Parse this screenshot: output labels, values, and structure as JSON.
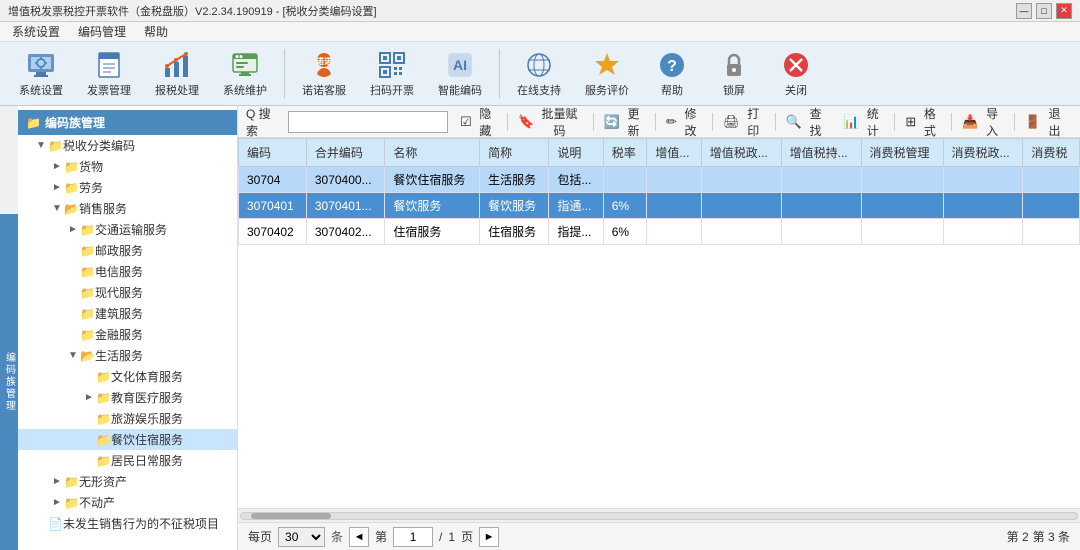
{
  "title_bar": {
    "text": "增值税发票税控开票软件（金税盘版）V2.2.34.190919 - [税收分类编码设置]",
    "controls": [
      "—",
      "□",
      "✕"
    ]
  },
  "menu": {
    "items": [
      "系统设置",
      "编码管理",
      "帮助"
    ]
  },
  "toolbar": {
    "buttons": [
      {
        "id": "sys-settings",
        "icon": "⚙",
        "label": "系统设置"
      },
      {
        "id": "invoice-mgmt",
        "icon": "📋",
        "label": "发票管理"
      },
      {
        "id": "tax-process",
        "icon": "📊",
        "label": "报税处理"
      },
      {
        "id": "sys-maintain",
        "icon": "🔧",
        "label": "系统维护"
      },
      {
        "separator": true
      },
      {
        "id": "nuonuo",
        "icon": "👤",
        "label": "诺诺客服"
      },
      {
        "id": "scan",
        "icon": "📷",
        "label": "扫码开票"
      },
      {
        "id": "smart-code",
        "icon": "🧠",
        "label": "智能编码"
      },
      {
        "separator": true
      },
      {
        "id": "online-support",
        "icon": "🌐",
        "label": "在线支持"
      },
      {
        "id": "service-eval",
        "icon": "⭐",
        "label": "服务评价"
      },
      {
        "id": "help",
        "icon": "❓",
        "label": "帮助"
      },
      {
        "id": "lock",
        "icon": "🔒",
        "label": "锁屏"
      },
      {
        "id": "close",
        "icon": "✕",
        "label": "关闭"
      }
    ]
  },
  "left_badge": "编码族管理",
  "left_panel": {
    "header": "编码族管理",
    "tree": [
      {
        "level": 0,
        "expand": "▼",
        "folder": true,
        "label": "税收分类编码"
      },
      {
        "level": 1,
        "expand": "►",
        "folder": true,
        "label": "货物"
      },
      {
        "level": 1,
        "expand": "►",
        "folder": true,
        "label": "劳务"
      },
      {
        "level": 1,
        "expand": "▼",
        "folder": true,
        "label": "销售服务"
      },
      {
        "level": 2,
        "expand": "►",
        "folder": true,
        "label": "交通运输服务"
      },
      {
        "level": 2,
        "expand": "",
        "folder": true,
        "label": "邮政服务"
      },
      {
        "level": 2,
        "expand": "",
        "folder": true,
        "label": "电信服务"
      },
      {
        "level": 2,
        "expand": "",
        "folder": true,
        "label": "现代服务"
      },
      {
        "level": 2,
        "expand": "",
        "folder": true,
        "label": "建筑服务"
      },
      {
        "level": 2,
        "expand": "",
        "folder": true,
        "label": "金融服务"
      },
      {
        "level": 2,
        "expand": "▼",
        "folder": true,
        "label": "生活服务"
      },
      {
        "level": 3,
        "expand": "",
        "folder": true,
        "label": "文化体育服务"
      },
      {
        "level": 3,
        "expand": "►",
        "folder": true,
        "label": "教育医疗服务"
      },
      {
        "level": 3,
        "expand": "",
        "folder": true,
        "label": "旅游娱乐服务"
      },
      {
        "level": 3,
        "expand": "",
        "folder": true,
        "label": "餐饮住宿服务",
        "selected": true
      },
      {
        "level": 3,
        "expand": "",
        "folder": true,
        "label": "居民日常服务"
      },
      {
        "level": 1,
        "expand": "►",
        "folder": true,
        "label": "无形资产"
      },
      {
        "level": 1,
        "expand": "►",
        "folder": true,
        "label": "不动产"
      },
      {
        "level": 0,
        "expand": "",
        "folder": false,
        "label": "未发生销售行为的不征税项目"
      }
    ]
  },
  "right_panel": {
    "search": {
      "label": "Q 搜索",
      "placeholder": ""
    },
    "actions": [
      {
        "id": "hide",
        "icon": "☑",
        "label": "隐藏"
      },
      {
        "id": "batch-assign",
        "icon": "📌",
        "label": "批量赋码"
      },
      {
        "id": "update",
        "icon": "🔄",
        "label": "更新"
      },
      {
        "id": "modify",
        "icon": "✏",
        "label": "修改"
      },
      {
        "id": "print",
        "icon": "🖨",
        "label": "打印"
      },
      {
        "id": "query",
        "icon": "🔍",
        "label": "查找"
      },
      {
        "id": "stats",
        "icon": "📊",
        "label": "统计"
      },
      {
        "id": "format",
        "icon": "⊞",
        "label": "格式"
      },
      {
        "id": "import",
        "icon": "📥",
        "label": "导入"
      },
      {
        "id": "exit",
        "icon": "🚪",
        "label": "退出"
      }
    ],
    "table": {
      "columns": [
        "编码",
        "合并编码",
        "名称",
        "简称",
        "说明",
        "税率",
        "增值...",
        "增值税政...",
        "增值税持...",
        "消费税管理",
        "消费税政...",
        "消费税"
      ],
      "rows": [
        {
          "code": "30704",
          "merge_code": "3070400...",
          "name": "餐饮住宿服务",
          "abbr": "生活服务",
          "note": "包括...",
          "rate": "",
          "v1": "",
          "v2": "",
          "v3": "",
          "c1": "",
          "c2": "",
          "highlight": false
        },
        {
          "code": "3070401",
          "merge_code": "3070401...",
          "name": "餐饮服务",
          "abbr": "餐饮服务",
          "note": "指通...",
          "rate": "6%",
          "v1": "",
          "v2": "",
          "v3": "",
          "c1": "",
          "c2": "",
          "highlight": true
        },
        {
          "code": "3070402",
          "merge_code": "3070402...",
          "name": "住宿服务",
          "abbr": "住宿服务",
          "note": "指提...",
          "rate": "6%",
          "v1": "",
          "v2": "",
          "v3": "",
          "c1": "",
          "c2": "",
          "highlight": false
        }
      ]
    },
    "pagination": {
      "per_page_label": "每页",
      "per_page_value": "30",
      "total_label": "条",
      "prev": "◄",
      "next": "►",
      "page_label": "第",
      "current_page": "1",
      "total_pages": "1",
      "page_unit": "页",
      "page2": "第 2",
      "page3": "第 3 条"
    }
  }
}
